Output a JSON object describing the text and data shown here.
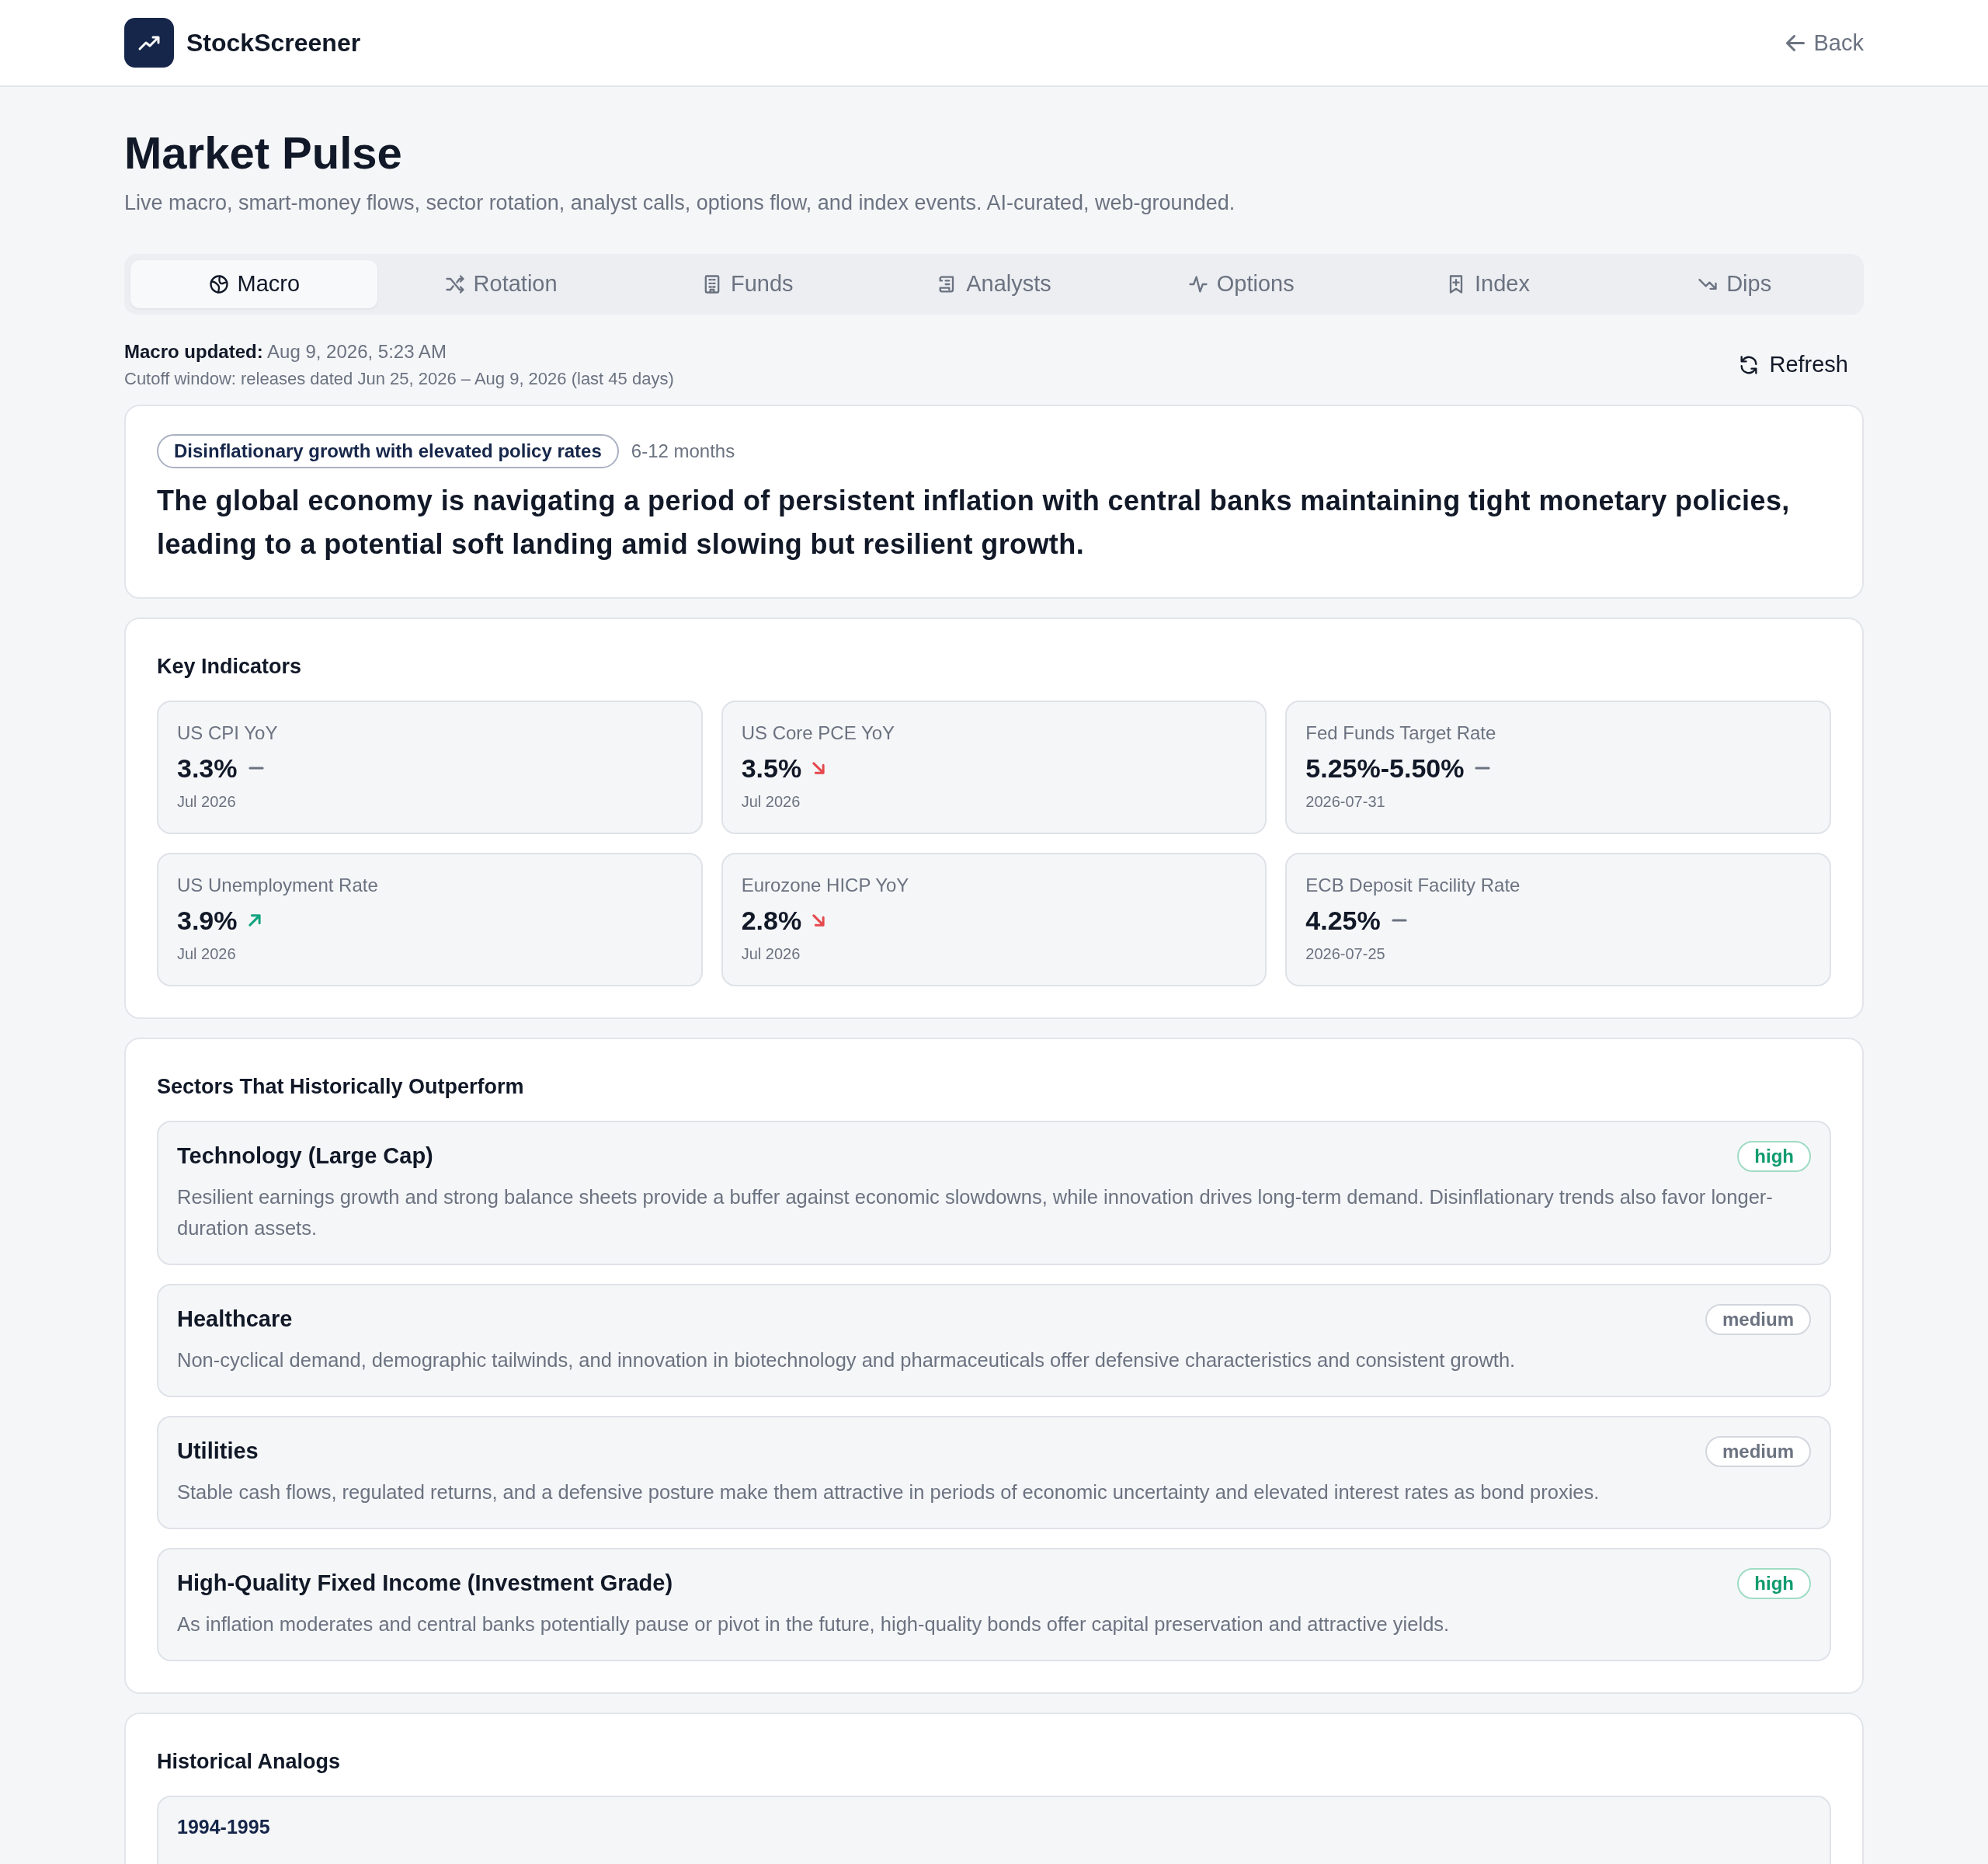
{
  "header": {
    "brand": "StockScreener",
    "back": "Back"
  },
  "page": {
    "title": "Market Pulse",
    "subtitle": "Live macro, smart-money flows, sector rotation, analyst calls, options flow, and index events. AI-curated, web-grounded."
  },
  "tabs": [
    {
      "label": "Macro",
      "selected": true
    },
    {
      "label": "Rotation",
      "selected": false
    },
    {
      "label": "Funds",
      "selected": false
    },
    {
      "label": "Analysts",
      "selected": false
    },
    {
      "label": "Options",
      "selected": false
    },
    {
      "label": "Index",
      "selected": false
    },
    {
      "label": "Dips",
      "selected": false
    }
  ],
  "status": {
    "updated_label": "Macro updated:",
    "updated_value": "Aug 9, 2026, 5:23 AM",
    "cutoff": "Cutoff window: releases dated Jun 25, 2026 – Aug 9, 2026 (last 45 days)",
    "refresh": "Refresh"
  },
  "regime": {
    "tag": "Disinflationary growth with elevated policy rates",
    "horizon": "6-12 months",
    "summary": "The global economy is navigating a period of persistent inflation with central banks maintaining tight monetary policies, leading to a potential soft landing amid slowing but resilient growth."
  },
  "indicators": {
    "title": "Key Indicators",
    "items": [
      {
        "name": "US CPI YoY",
        "value": "3.3%",
        "kind": "flat",
        "date": "Jul 2026"
      },
      {
        "name": "US Core PCE YoY",
        "value": "3.5%",
        "kind": "down",
        "date": "Jul 2026"
      },
      {
        "name": "Fed Funds Target Rate",
        "value": "5.25%-5.50%",
        "kind": "flat",
        "date": "2026-07-31"
      },
      {
        "name": "US Unemployment Rate",
        "value": "3.9%",
        "kind": "up",
        "date": "Jul 2026"
      },
      {
        "name": "Eurozone HICP YoY",
        "value": "2.8%",
        "kind": "down",
        "date": "Jul 2026"
      },
      {
        "name": "ECB Deposit Facility Rate",
        "value": "4.25%",
        "kind": "flat",
        "date": "2026-07-25"
      }
    ]
  },
  "sectors": {
    "title": "Sectors That Historically Outperform",
    "items": [
      {
        "name": "Technology (Large Cap)",
        "confidence": "high",
        "reason": "Resilient earnings growth and strong balance sheets provide a buffer against economic slowdowns, while innovation drives long-term demand. Disinflationary trends also favor longer-duration assets."
      },
      {
        "name": "Healthcare",
        "confidence": "medium",
        "reason": "Non-cyclical demand, demographic tailwinds, and innovation in biotechnology and pharmaceuticals offer defensive characteristics and consistent growth."
      },
      {
        "name": "Utilities",
        "confidence": "medium",
        "reason": "Stable cash flows, regulated returns, and a defensive posture make them attractive in periods of economic uncertainty and elevated interest rates as bond proxies."
      },
      {
        "name": "High-Quality Fixed Income (Investment Grade)",
        "confidence": "high",
        "reason": "As inflation moderates and central banks potentially pause or pivot in the future, high-quality bonds offer capital preservation and attractive yields."
      }
    ]
  },
  "analogs": {
    "title": "Historical Analogs",
    "items": [
      {
        "period": "1994-1995"
      }
    ]
  }
}
